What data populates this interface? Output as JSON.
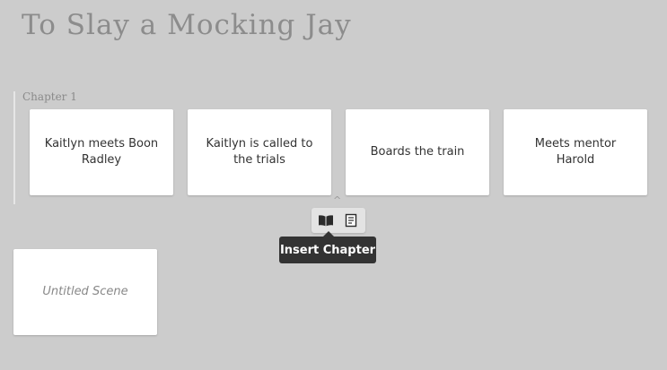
{
  "story": {
    "title": "To Slay a Mocking Jay"
  },
  "chapters": [
    {
      "label": "Chapter 1",
      "scenes": [
        "Kaitlyn meets Boon Radley",
        "Kaitlyn is called to the trials",
        "Boards the train",
        "Meets mentor Harold"
      ]
    }
  ],
  "toolbar": {
    "caret_icon": "chevron-up-icon",
    "insert_chapter_icon": "book-icon",
    "insert_scene_icon": "page-icon",
    "tooltip": "Insert Chapter"
  },
  "unassigned_scenes": [
    "Untitled Scene"
  ]
}
